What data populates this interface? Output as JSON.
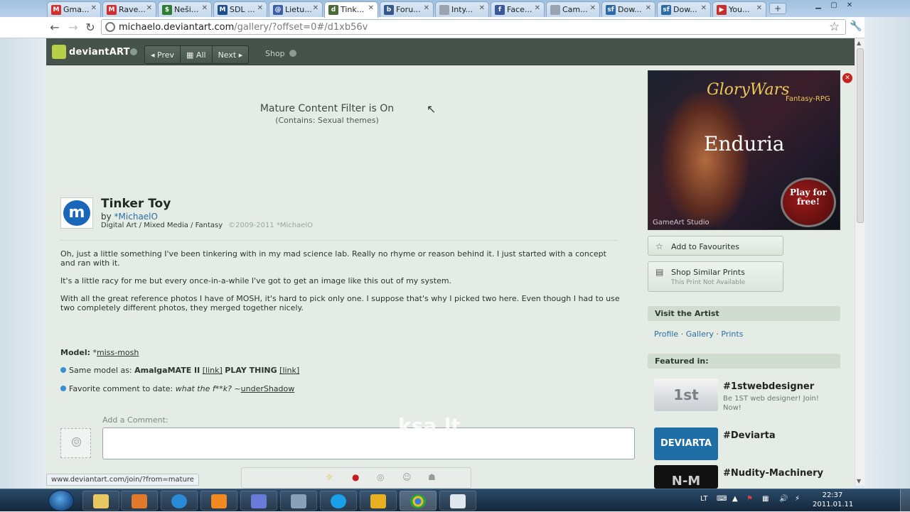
{
  "browser": {
    "tabs": [
      {
        "label": "Gma...",
        "icon": "gmail-icon",
        "color": "#d32f2f",
        "glyph": "M"
      },
      {
        "label": "Rave...",
        "icon": "gmail-icon",
        "color": "#d32f2f",
        "glyph": "M"
      },
      {
        "label": "Neši...",
        "icon": "dollar-icon",
        "color": "#2e7d32",
        "glyph": "$"
      },
      {
        "label": "SDL ...",
        "icon": "sdl-icon",
        "color": "#1e4d8a",
        "glyph": "M"
      },
      {
        "label": "Lietu...",
        "icon": "globe-icon",
        "color": "#3a5ea8",
        "glyph": "@"
      },
      {
        "label": "Tink...",
        "icon": "deviantart-icon",
        "color": "#4a6b3a",
        "glyph": "d",
        "active": true
      },
      {
        "label": "Foru...",
        "icon": "blog-icon",
        "color": "#37588a",
        "glyph": "b"
      },
      {
        "label": "Inty...",
        "icon": "page-icon",
        "color": "#9aa4b0",
        "glyph": ""
      },
      {
        "label": "Face...",
        "icon": "facebook-icon",
        "color": "#3b5998",
        "glyph": "f"
      },
      {
        "label": "Cam...",
        "icon": "page-icon",
        "color": "#9aa4b0",
        "glyph": ""
      },
      {
        "label": "Dow...",
        "icon": "sourceforge-icon",
        "color": "#2d6aa8",
        "glyph": "sf"
      },
      {
        "label": "Dow...",
        "icon": "sourceforge-icon",
        "color": "#2d6aa8",
        "glyph": "sf"
      },
      {
        "label": "You...",
        "icon": "youtube-icon",
        "color": "#c4302b",
        "glyph": "▶"
      }
    ],
    "url_host": "michaelo.deviantart.com",
    "url_rest": "/gallery/?offset=0#/d1xb56v"
  },
  "da_header": {
    "brand": "deviantART",
    "prev": "Prev",
    "all": "All",
    "next": "Next",
    "shop": "Shop"
  },
  "mature": {
    "title": "Mature Content Filter is On",
    "subtitle": "(Contains: Sexual themes)"
  },
  "deviation": {
    "title": "Tinker Toy",
    "by": "by ",
    "artist": "*MichaelO",
    "category": "Digital Art / Mixed Media / Fantasy",
    "copyright": "©2009-2011 *MichaelO",
    "paragraphs": [
      "Oh, just a little something I've been tinkering with in my mad science lab. Really no rhyme or reason behind it. I just started with a concept and ran with it.",
      "It's a little racy for me but every once-in-a-while I've got to get an image like this out of my system.",
      "With all the great reference photos I have of MOSH, it's hard to pick only one. I suppose that's why I picked two here. Even though I had to use two completely different photos, they merged together nicely."
    ],
    "model_label": "Model:",
    "model_prefix": " *",
    "model_link": "miss-mosh",
    "bullet1_text": "Same model as: ",
    "bullet1_a": "AmalgaMATE II",
    "bullet1_link": "[link]",
    "bullet1_b": "PLAY THING",
    "bullet2_text": "Favorite comment to date: ",
    "bullet2_quote": "what the f**k?",
    "bullet2_sep": " ~",
    "bullet2_user": "underShadow"
  },
  "comment": {
    "label": "Add a Comment:"
  },
  "sidebar": {
    "ad": {
      "brand": "GloryWars",
      "tag": "Fantasy-RPG",
      "name": "Enduria",
      "cta": "Play for free!",
      "studio": "GameArt Studio"
    },
    "add_fav": "Add to Favourites",
    "shop_prints": "Shop Similar Prints",
    "shop_prints_sub": "This Print Not Available",
    "visit_artist": "Visit the Artist",
    "links": [
      "Profile",
      "Gallery",
      "Prints"
    ],
    "featured_in": "Featured in:",
    "featured": [
      {
        "name": "#1stwebdesigner",
        "desc": "Be 1ST web designer! Join! Now!",
        "thumb": "1st"
      },
      {
        "name": "#Deviarta",
        "desc": "",
        "thumb": "DEVIARTA"
      },
      {
        "name": "#Nudity-Machinery",
        "desc": "",
        "thumb": "N-M"
      }
    ]
  },
  "overlay_text": "ksa.lt",
  "status_url": "www.deviantart.com/join/?from=mature",
  "taskbar": {
    "lang": "LT",
    "time": "22:37",
    "date": "2011.01.11"
  }
}
